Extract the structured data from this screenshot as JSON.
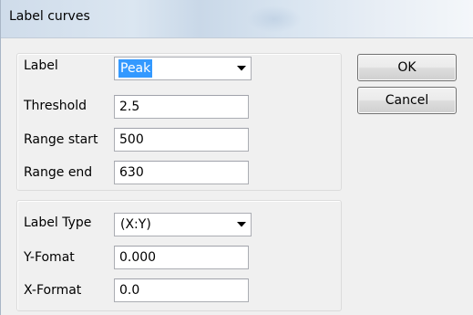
{
  "window": {
    "title": "Label curves"
  },
  "label_group": {
    "label": {
      "caption": "Label",
      "value": "Peak"
    },
    "threshold": {
      "caption": "Threshold",
      "value": "2.5"
    },
    "range_start": {
      "caption": "Range start",
      "value": "500"
    },
    "range_end": {
      "caption": "Range end",
      "value": "630"
    }
  },
  "format_group": {
    "label_type": {
      "caption": "Label Type",
      "value": "(X:Y)"
    },
    "y_format": {
      "caption": "Y-Fomat",
      "value": "0.000"
    },
    "x_format": {
      "caption": "X-Format",
      "value": "0.0"
    }
  },
  "buttons": {
    "ok": "OK",
    "cancel": "Cancel"
  },
  "icons": {
    "dropdown": "chevron-down-icon"
  },
  "colors": {
    "selection": "#3399ff",
    "titlebar": "#d3e0ee",
    "dialog_bg": "#f0f0f0"
  }
}
